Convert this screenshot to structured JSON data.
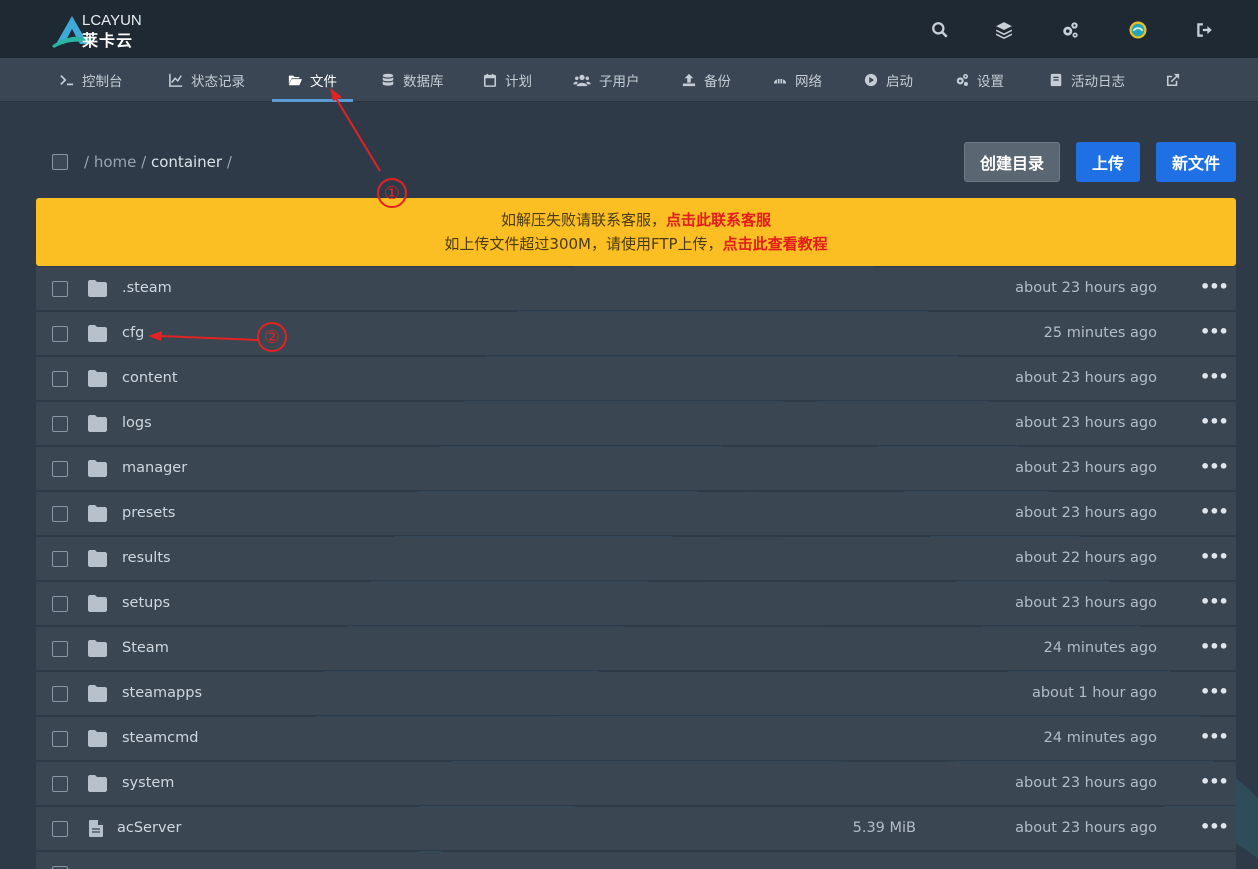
{
  "logo": {
    "text_en": "LCAYUN",
    "text_cn": "莱卡云"
  },
  "top_icons": [
    "search-icon",
    "layers-icon",
    "cogs-icon",
    "avatar-icon",
    "logout-icon"
  ],
  "nav": {
    "items": [
      {
        "label": "控制台",
        "icon": "terminal-icon"
      },
      {
        "label": "状态记录",
        "icon": "chart-icon"
      },
      {
        "label": "文件",
        "icon": "folder-open-icon",
        "active": true
      },
      {
        "label": "数据库",
        "icon": "database-icon"
      },
      {
        "label": "计划",
        "icon": "calendar-icon"
      },
      {
        "label": "子用户",
        "icon": "users-icon"
      },
      {
        "label": "备份",
        "icon": "upload-icon"
      },
      {
        "label": "网络",
        "icon": "network-icon"
      },
      {
        "label": "启动",
        "icon": "play-icon"
      },
      {
        "label": "设置",
        "icon": "cogs-icon"
      },
      {
        "label": "活动日志",
        "icon": "log-icon"
      },
      {
        "label": "",
        "icon": "external-link-icon"
      }
    ]
  },
  "breadcrumb": {
    "sep": "/",
    "home": "home",
    "current": "container"
  },
  "buttons": {
    "create_dir": "创建目录",
    "upload": "上传",
    "new_file": "新文件"
  },
  "notice": {
    "line1_text": "如解压失败请联系客服，",
    "line1_link": "点击此联系客服",
    "line2_text": "如上传文件超过300M，请使用FTP上传，",
    "line2_link": "点击此查看教程"
  },
  "files": [
    {
      "name": ".steam",
      "type": "folder",
      "size": "",
      "modified": "about 23 hours ago"
    },
    {
      "name": "cfg",
      "type": "folder",
      "size": "",
      "modified": "25 minutes ago"
    },
    {
      "name": "content",
      "type": "folder",
      "size": "",
      "modified": "about 23 hours ago"
    },
    {
      "name": "logs",
      "type": "folder",
      "size": "",
      "modified": "about 23 hours ago"
    },
    {
      "name": "manager",
      "type": "folder",
      "size": "",
      "modified": "about 23 hours ago"
    },
    {
      "name": "presets",
      "type": "folder",
      "size": "",
      "modified": "about 23 hours ago"
    },
    {
      "name": "results",
      "type": "folder",
      "size": "",
      "modified": "about 22 hours ago"
    },
    {
      "name": "setups",
      "type": "folder",
      "size": "",
      "modified": "about 23 hours ago"
    },
    {
      "name": "Steam",
      "type": "folder",
      "size": "",
      "modified": "24 minutes ago"
    },
    {
      "name": "steamapps",
      "type": "folder",
      "size": "",
      "modified": "about 1 hour ago"
    },
    {
      "name": "steamcmd",
      "type": "folder",
      "size": "",
      "modified": "24 minutes ago"
    },
    {
      "name": "system",
      "type": "folder",
      "size": "",
      "modified": "about 23 hours ago"
    },
    {
      "name": "acServer",
      "type": "file",
      "size": "5.39 MiB",
      "modified": "about 23 hours ago"
    }
  ],
  "row_menu_label": "•••",
  "annotations": {
    "one": "①",
    "two": "②"
  },
  "colors": {
    "notice_bg": "#fbbf24",
    "notice_link": "#e21c1c",
    "primary": "#1f6fe5",
    "annotation": "#e32222"
  }
}
